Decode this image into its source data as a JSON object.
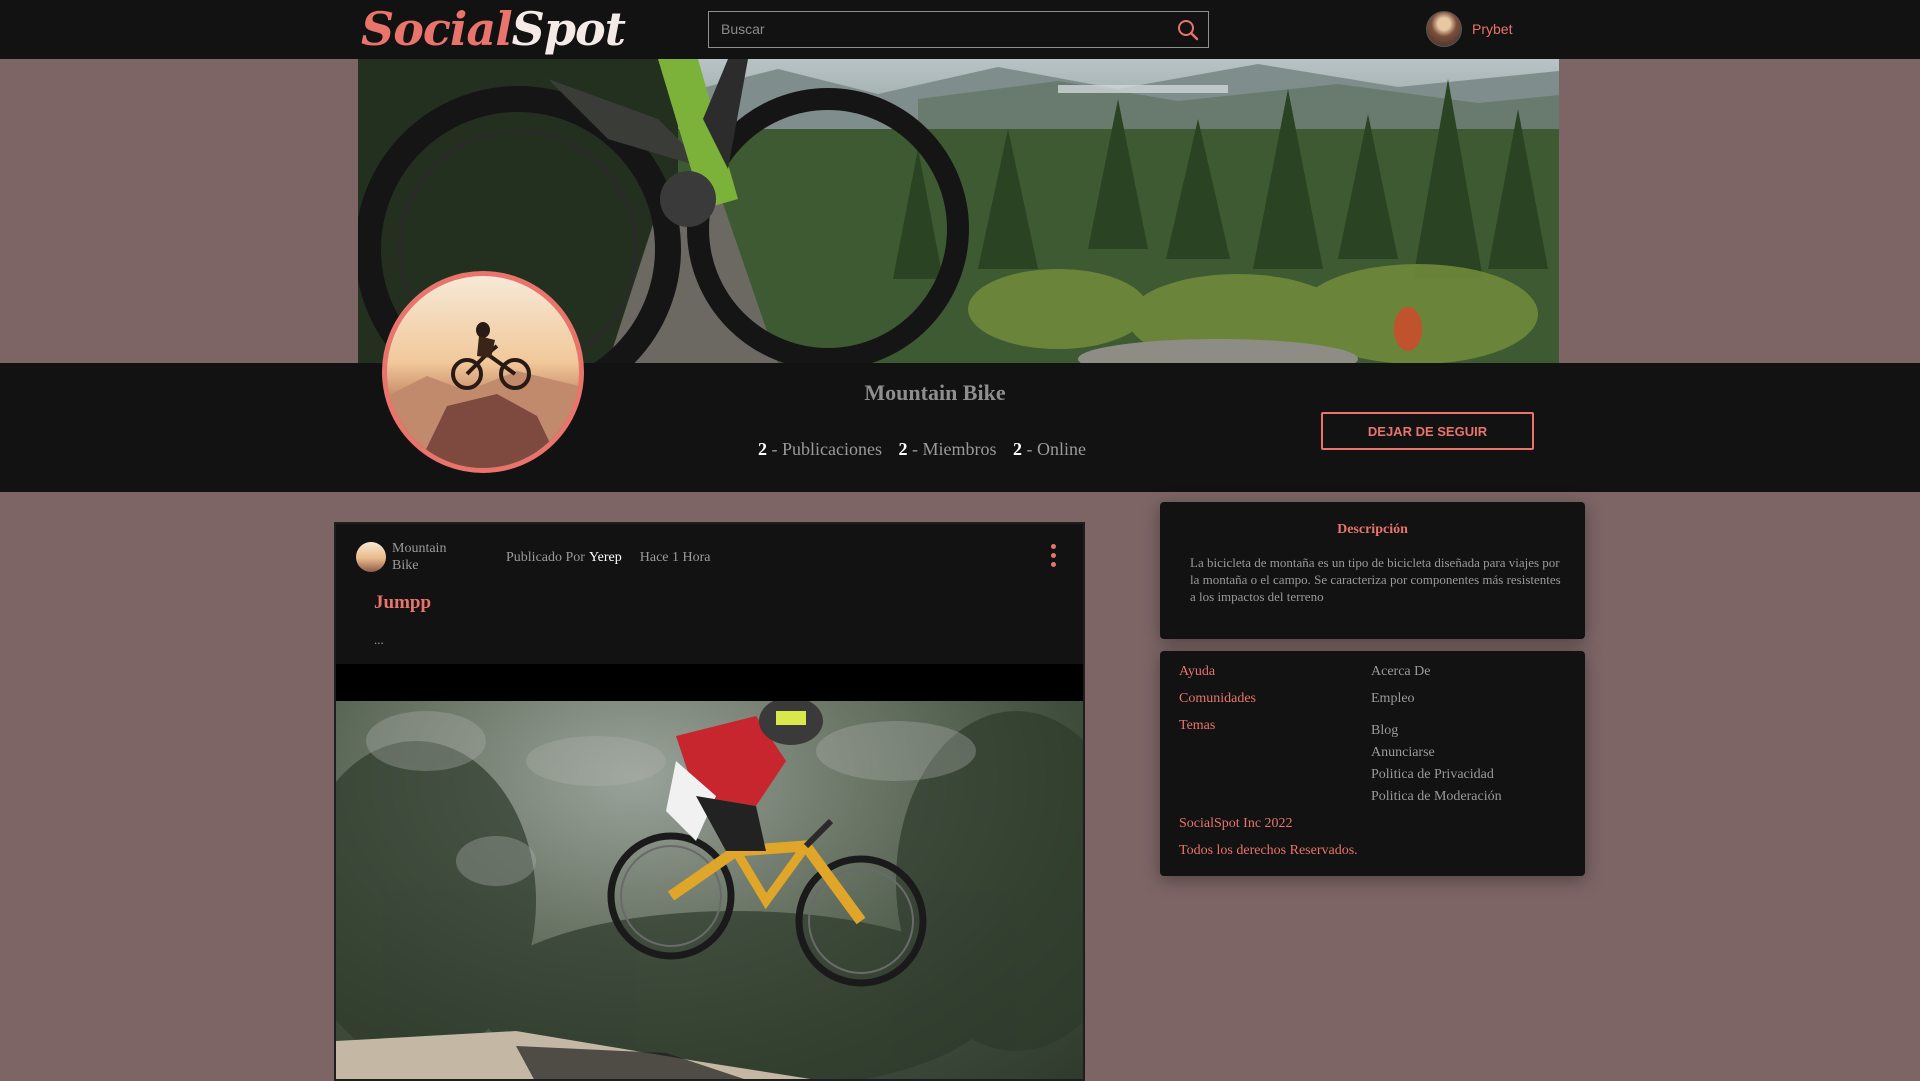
{
  "header": {
    "logo_part1": "Social",
    "logo_part2": "Spot",
    "search_placeholder": "Buscar",
    "username": "Prybet"
  },
  "community": {
    "name": "Mountain Bike",
    "stats": [
      {
        "count": "2",
        "label": "Publicaciones"
      },
      {
        "count": "2",
        "label": "Miembros"
      },
      {
        "count": "2",
        "label": "Online"
      }
    ],
    "follow_button": "DEJAR DE SEGUIR"
  },
  "post": {
    "community": "Mountain Bike",
    "published_by": "Publicado Por",
    "author": "Yerep",
    "time": "Hace 1 Hora",
    "title": "Jumpp",
    "excerpt": "..."
  },
  "sidebar": {
    "description_title": "Descripción",
    "description_text": "La bicicleta de montaña es un tipo de bicicleta diseñada para viajes por la montaña o el campo. Se caracteriza por componentes más resistentes a los impactos del terreno",
    "links_left": [
      "Ayuda",
      "Comunidades",
      "Temas"
    ],
    "links_right": [
      "Acerca De",
      "Empleo",
      "Blog",
      "Anunciarse",
      "Politica de Privacidad",
      "Politica de Moderación"
    ],
    "copyright": "SocialSpot Inc 2022",
    "rights": "Todos los derechos Reservados."
  },
  "colors": {
    "accent": "#e8746c",
    "background": "#7d6566",
    "dark": "#121212"
  }
}
